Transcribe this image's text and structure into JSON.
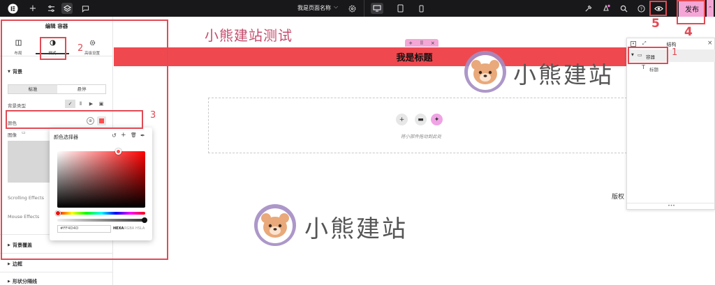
{
  "topbar": {
    "page_name": "我是页面名称",
    "publish_label": "发布"
  },
  "panel": {
    "title": "编辑 容器",
    "tabs": [
      {
        "label": "布局",
        "icon": "layout-icon"
      },
      {
        "label": "样式",
        "icon": "style-contrast-icon"
      },
      {
        "label": "高级设置",
        "icon": "gear-icon"
      }
    ],
    "background_section": "背景",
    "toggle": [
      "标准",
      "悬停"
    ],
    "bg_type_label": "背景类型",
    "color_label": "颜色",
    "image_label": "图像",
    "scrolling_effects": "Scrolling Effects",
    "mouse_effects": "Mouse Effects",
    "bg_overlay": "背景覆盖",
    "border": "边框",
    "shape_divider": "形状分隔线"
  },
  "color_picker": {
    "title": "颜色选择器",
    "hex_value": "#FF4D4D",
    "modes": [
      "HEXA",
      "RGBA",
      "HSLA"
    ]
  },
  "canvas": {
    "site_title": "小熊建站测试",
    "heading": "我是标题",
    "drop_hint": "将小部件拖动到此处",
    "brand_text": "小熊建站",
    "footer_fragment": "版权"
  },
  "navigator": {
    "title": "结构",
    "items": [
      "容器",
      "标题"
    ]
  },
  "annotations": [
    "1",
    "2",
    "3",
    "4",
    "5"
  ],
  "colors": {
    "accent": "#f4a6d6",
    "banner": "#f0484f",
    "annotation": "#e04b55",
    "picked": "#FF4D4D"
  }
}
